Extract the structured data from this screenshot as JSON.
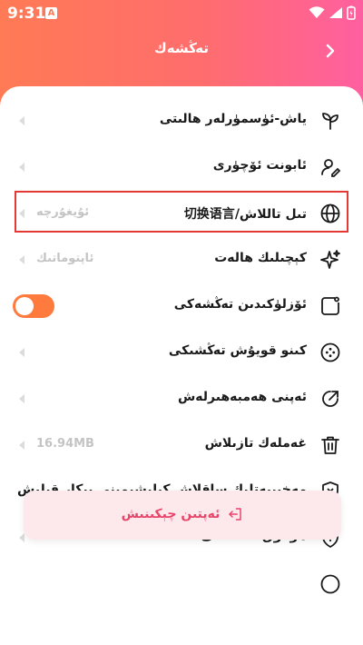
{
  "status": {
    "time": "9:31",
    "notif_badge": "A"
  },
  "header": {
    "title": "تەڭشەك"
  },
  "items": [
    {
      "label": "ياش-ئۈسمۈرلەر ھالىتى",
      "value": "",
      "icon": "sprout-icon"
    },
    {
      "label": "ئابونت ئۆچۈرى",
      "value": "",
      "icon": "user-edit-icon"
    },
    {
      "label": "تىل تاللاش/切换语言",
      "value": "ئۇيغۇرچە",
      "icon": "globe-icon"
    },
    {
      "label": "كېچىلىك ھالەت",
      "value": "ئاپتوماتىك",
      "icon": "sparkle-icon"
    },
    {
      "label": "ئۆزلۈكىدىن تەڭشەكى",
      "value": "",
      "icon": "square-dot-icon"
    },
    {
      "label": "كىنو قويۇش تەڭشىكى",
      "value": "",
      "icon": "gamepad-icon"
    },
    {
      "label": "ئەپنى ھەمبەھىرلەش",
      "value": "",
      "icon": "share-arrow-icon"
    },
    {
      "label": "غەملەك تازىلاش",
      "value": "16.94MB",
      "icon": "trash-icon"
    },
    {
      "label": "مەخپىيەتلىك ساقلاش كېلىشىمىنى بىكار قىلىش",
      "value": "",
      "icon": "shield-x-icon"
    },
    {
      "label": "ھوقۇق تەڭشىكى",
      "value": "",
      "icon": "shield-pin-icon"
    }
  ],
  "logout": {
    "label": "ئەپتىن چېكىنىش",
    "icon": "logout-icon"
  },
  "colors": {
    "accent": "#ff7a3d",
    "highlight": "#e53935",
    "logout_text": "#e8456b"
  }
}
